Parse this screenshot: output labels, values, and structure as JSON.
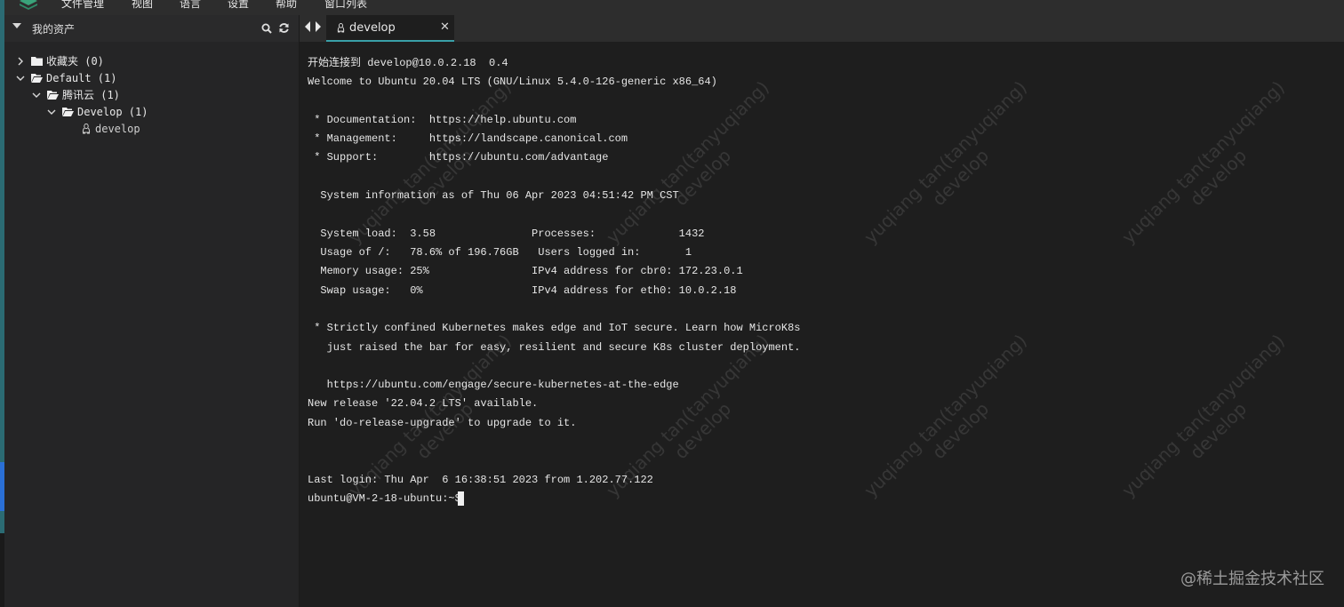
{
  "menubar": {
    "items": [
      "文件管理",
      "视图",
      "语言",
      "设置",
      "帮助",
      "窗口列表"
    ]
  },
  "sidebar": {
    "title": "我的资产",
    "tree": [
      {
        "label": "收藏夹 (0)",
        "expanded": false,
        "icon": "folder-icon"
      },
      {
        "label": "Default (1)",
        "expanded": true,
        "icon": "folder-open-icon"
      },
      {
        "label": "腾讯云 (1)",
        "expanded": true,
        "icon": "folder-open-icon"
      },
      {
        "label": "Develop (1)",
        "expanded": true,
        "icon": "folder-open-icon"
      },
      {
        "label": "develop",
        "icon": "linux-icon"
      }
    ]
  },
  "tabs": [
    {
      "label": "develop",
      "icon": "linux-icon",
      "active": true
    }
  ],
  "terminal": {
    "lines": [
      "开始连接到 develop@10.0.2.18  0.4",
      "Welcome to Ubuntu 20.04 LTS (GNU/Linux 5.4.0-126-generic x86_64)",
      "",
      " * Documentation:  https://help.ubuntu.com",
      " * Management:     https://landscape.canonical.com",
      " * Support:        https://ubuntu.com/advantage",
      "",
      "  System information as of Thu 06 Apr 2023 04:51:42 PM CST",
      "",
      "  System load:  3.58               Processes:             1432",
      "  Usage of /:   78.6% of 196.76GB   Users logged in:       1",
      "  Memory usage: 25%                IPv4 address for cbr0: 172.23.0.1",
      "  Swap usage:   0%                 IPv4 address for eth0: 10.0.2.18",
      "",
      " * Strictly confined Kubernetes makes edge and IoT secure. Learn how MicroK8s",
      "   just raised the bar for easy, resilient and secure K8s cluster deployment.",
      "",
      "   https://ubuntu.com/engage/secure-kubernetes-at-the-edge",
      "New release '22.04.2 LTS' available.",
      "Run 'do-release-upgrade' to upgrade to it.",
      "",
      "",
      "Last login: Thu Apr  6 16:38:51 2023 from 1.202.77.122",
      "ubuntu@VM-2-18-ubuntu:~$ "
    ]
  },
  "watermark": {
    "line1": "yuqiang tan(tanyuqiang)",
    "line2": "develop"
  },
  "footer": {
    "credit": "@稀土掘金技术社区"
  },
  "colors": {
    "accent": "#3aa0a8",
    "background": "#1e1e1e",
    "sidebar": "#252526"
  }
}
